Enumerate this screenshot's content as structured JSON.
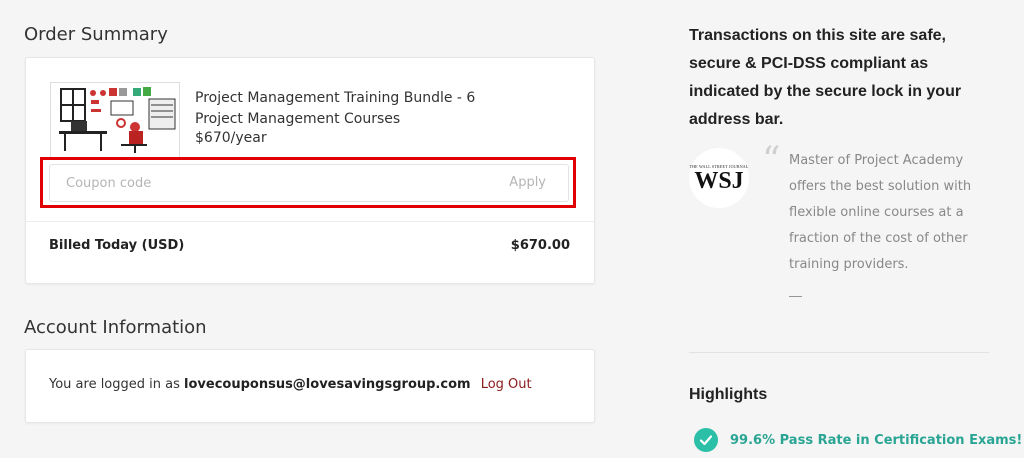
{
  "order_summary": {
    "title": "Order Summary",
    "product_name": "Project Management Training Bundle - 6 Project Management Courses",
    "product_price": "$670/year",
    "coupon_placeholder": "Coupon code",
    "apply_label": "Apply",
    "billed_label": "Billed Today (USD)",
    "billed_amount": "$670.00"
  },
  "account": {
    "title": "Account Information",
    "logged_in_prefix": "You are logged in as",
    "email": "lovecouponsus@lovesavingsgroup.com",
    "logout_label": "Log Out"
  },
  "sidebar": {
    "secure_text": "Transactions on this site are safe, secure & PCI-DSS compliant as indicated by the secure lock in your address bar.",
    "testimonial": {
      "logo_small": "THE WALL STREET JOURNAL",
      "logo_big": "WSJ",
      "quote_mark": "“",
      "quote": "Master of Project Academy offers the best solution with flexible online courses at a fraction of the cost of other training providers.",
      "attribution": "—"
    },
    "highlights": {
      "title": "Highlights",
      "items": [
        {
          "text": "99.6% Pass Rate in Certification Exams!",
          "icon": "check-circle-icon"
        }
      ]
    }
  },
  "colors": {
    "highlight_red": "#e00000",
    "teal": "#2bbfa8",
    "logout": "#8b1a1a"
  }
}
